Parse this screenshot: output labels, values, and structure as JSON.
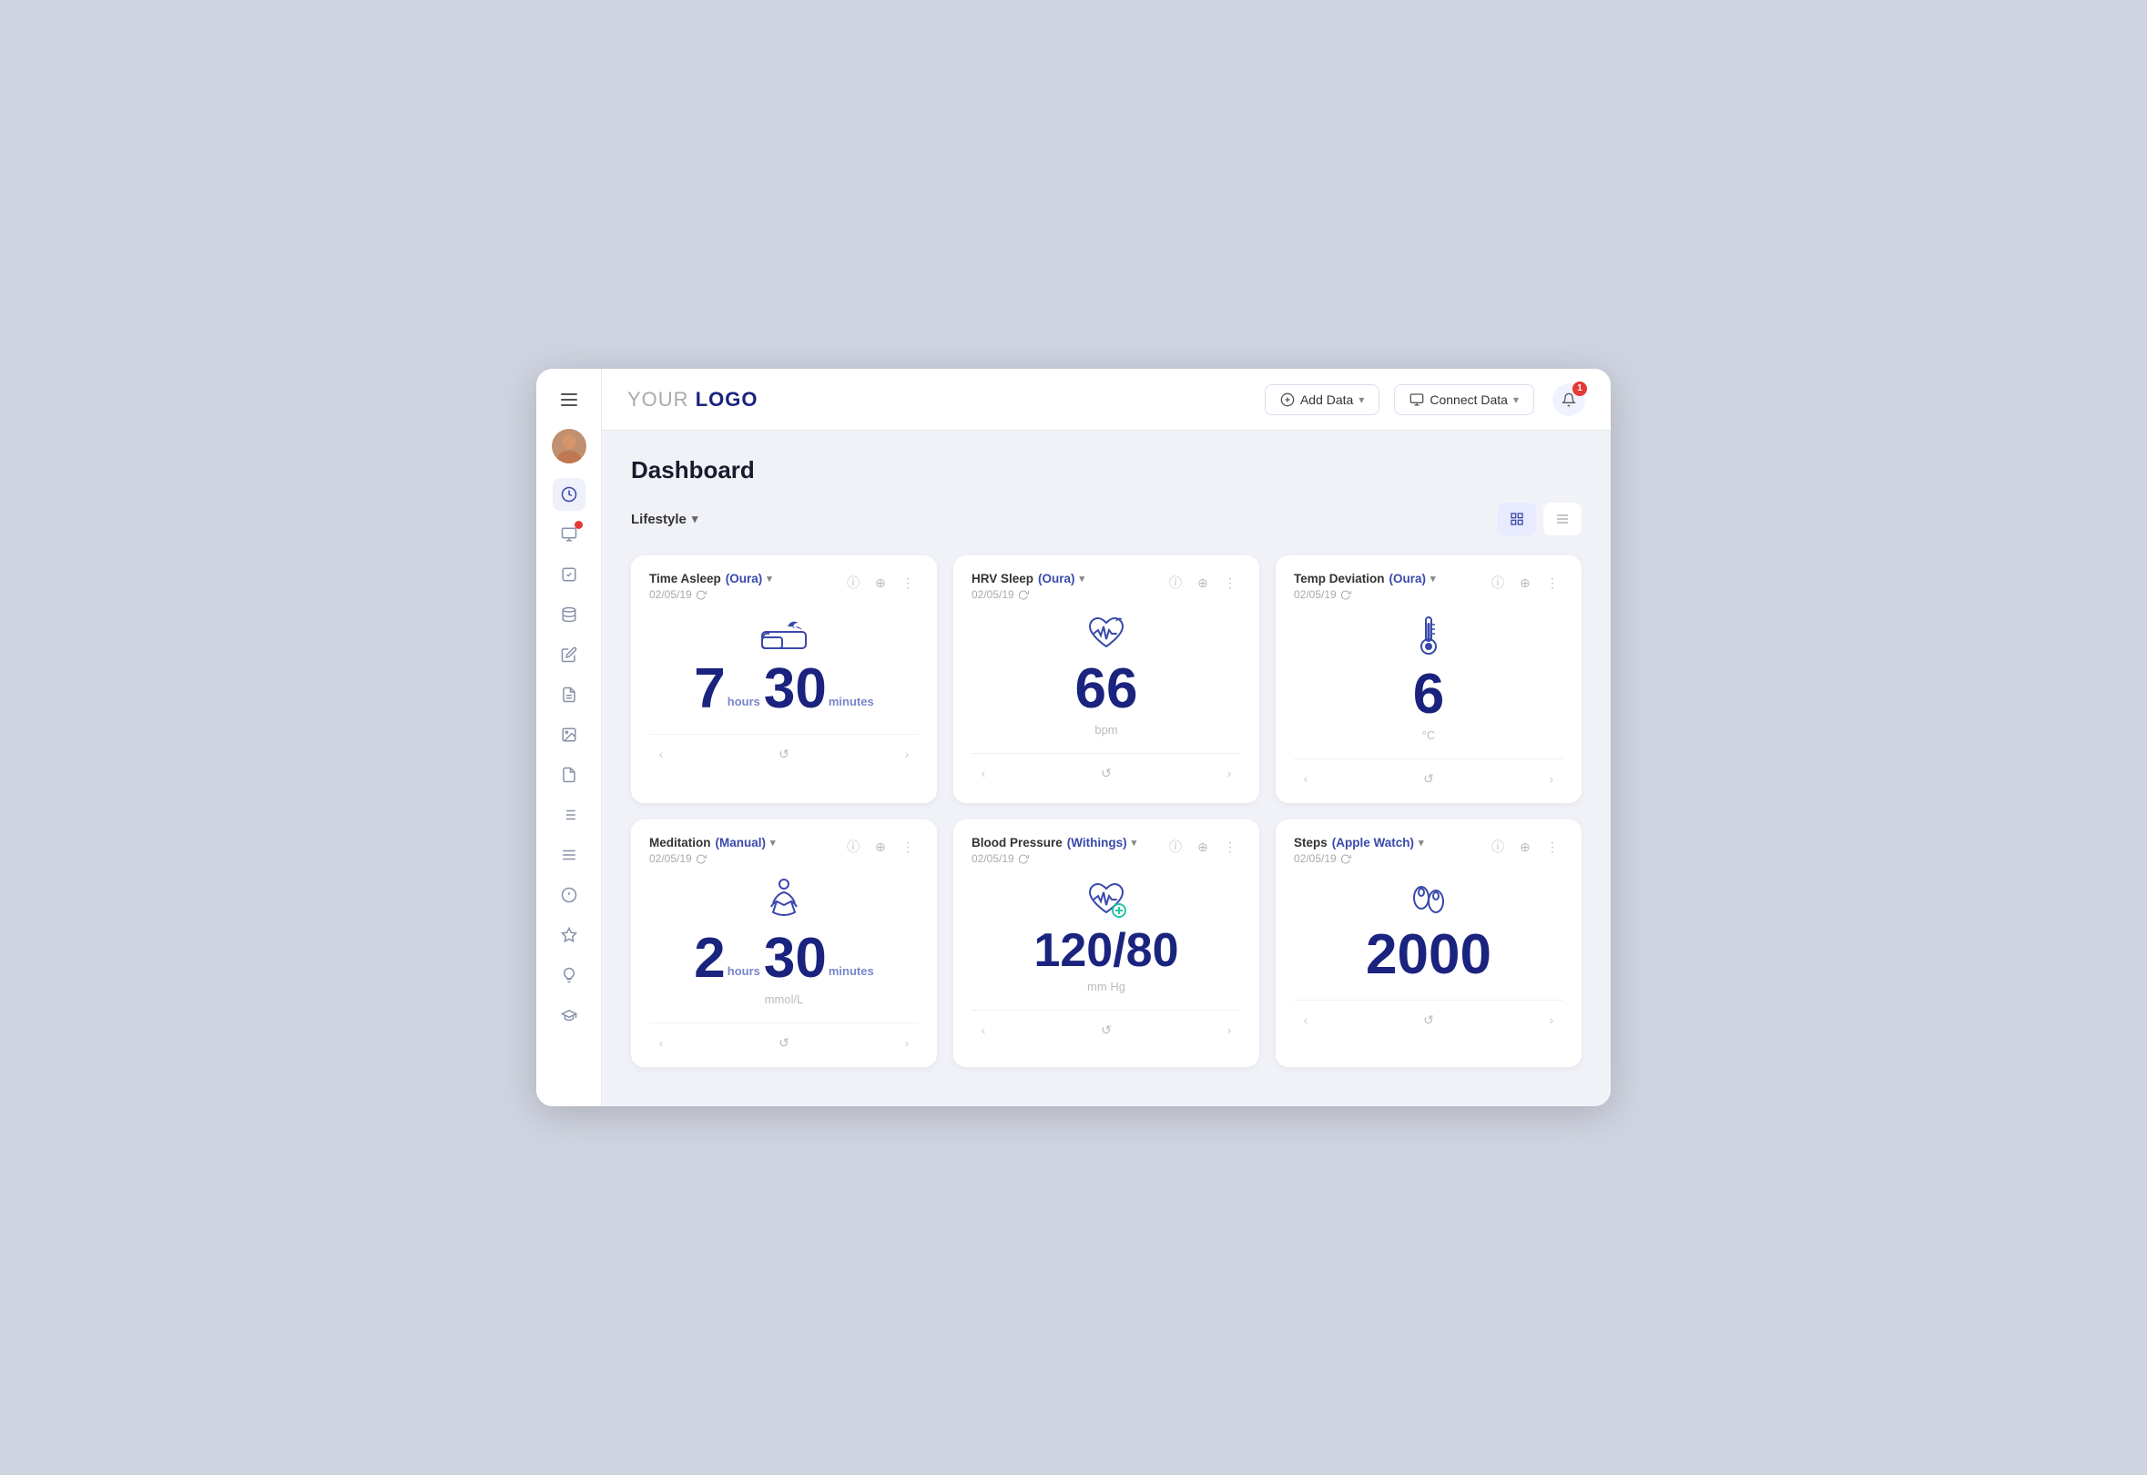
{
  "logo": {
    "text_light": "YOUR ",
    "text_bold": "LOGO"
  },
  "header": {
    "add_data_label": "Add Data",
    "connect_data_label": "Connect Data",
    "notification_count": "1"
  },
  "page": {
    "title": "Dashboard",
    "filter_label": "Lifestyle"
  },
  "view_toggle": {
    "grid_active": true
  },
  "cards": [
    {
      "id": "time-asleep",
      "title": "Time Asleep",
      "source": "(Oura)",
      "date": "02/05/19",
      "val1": "7",
      "unit1": "hours",
      "val2": "30",
      "unit2": "minutes",
      "unit_label": "",
      "icon": "sleep"
    },
    {
      "id": "hrv-sleep",
      "title": "HRV Sleep",
      "source": "(Oura)",
      "date": "02/05/19",
      "val1": "66",
      "unit1": "",
      "val2": "",
      "unit2": "",
      "unit_label": "bpm",
      "icon": "hrv"
    },
    {
      "id": "temp-deviation",
      "title": "Temp Deviation",
      "source": "(Oura)",
      "date": "02/05/19",
      "val1": "6",
      "unit1": "",
      "val2": "",
      "unit2": "",
      "unit_label": "°C",
      "icon": "temp"
    },
    {
      "id": "meditation",
      "title": "Meditation",
      "source": "(Manual)",
      "date": "02/05/19",
      "val1": "2",
      "unit1": "hours",
      "val2": "30",
      "unit2": "minutes",
      "unit_label": "mmol/L",
      "icon": "meditation"
    },
    {
      "id": "blood-pressure",
      "title": "Blood Pressure",
      "source": "(Withings)",
      "date": "02/05/19",
      "val1": "120/80",
      "unit1": "",
      "val2": "",
      "unit2": "",
      "unit_label": "mm Hg",
      "icon": "bp"
    },
    {
      "id": "steps",
      "title": "Steps",
      "source": "(Apple Watch)",
      "date": "02/05/19",
      "val1": "2000",
      "unit1": "",
      "val2": "",
      "unit2": "",
      "unit_label": "",
      "icon": "steps"
    }
  ],
  "sidebar": {
    "items": [
      {
        "icon": "clock",
        "active": true
      },
      {
        "icon": "monitor",
        "active": false,
        "badge": true
      },
      {
        "icon": "checkbox",
        "active": false
      },
      {
        "icon": "database",
        "active": false
      },
      {
        "icon": "pencil",
        "active": false
      },
      {
        "icon": "note",
        "active": false
      },
      {
        "icon": "image",
        "active": false
      },
      {
        "icon": "file",
        "active": false
      },
      {
        "icon": "list",
        "active": false
      },
      {
        "icon": "list2",
        "active": false
      },
      {
        "icon": "circle",
        "active": false
      },
      {
        "icon": "star",
        "active": false
      },
      {
        "icon": "bulb",
        "active": false
      },
      {
        "icon": "cap",
        "active": false
      }
    ]
  }
}
